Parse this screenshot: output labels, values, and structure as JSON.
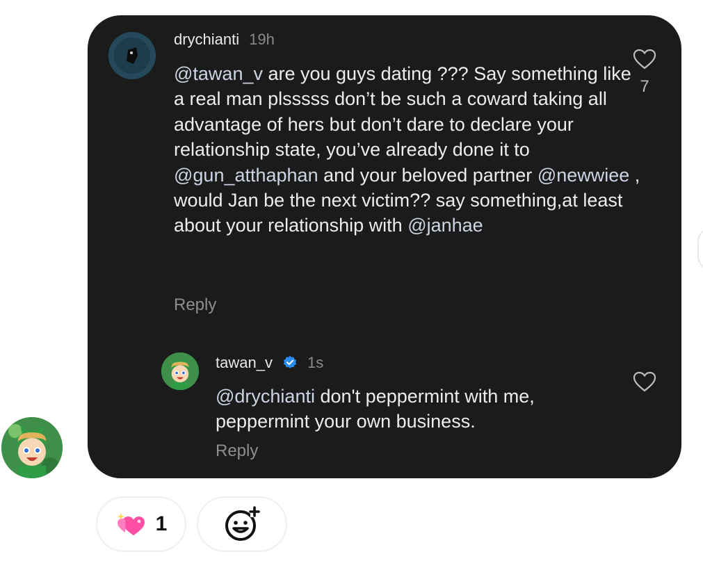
{
  "comments": [
    {
      "username": "drychianti",
      "time": "19h",
      "like_count": "7",
      "reply_label": "Reply",
      "segments": [
        {
          "text": "@tawan_v",
          "mention": true
        },
        {
          "text": " are you guys dating ??? Say something like a real man plsssss don’t be such a coward taking all advantage of hers but don’t dare to declare your relationship state, you’ve already done it to ",
          "mention": false
        },
        {
          "text": "@gun_atthaphan",
          "mention": true
        },
        {
          "text": " and your beloved partner ",
          "mention": false
        },
        {
          "text": "@newwiee",
          "mention": true
        },
        {
          "text": " , would Jan be the next victim?? say something,at least about your relationship with ",
          "mention": false
        },
        {
          "text": "@janhae",
          "mention": true
        }
      ]
    },
    {
      "username": "tawan_v",
      "verified": true,
      "time": "1s",
      "reply_label": "Reply",
      "segments": [
        {
          "text": "@drychianti",
          "mention": true
        },
        {
          "text": " don't peppermint with me, peppermint your own business.",
          "mention": false
        }
      ]
    }
  ],
  "reactions": [
    {
      "emoji": "sparkling-heart",
      "count": "1"
    }
  ],
  "colors": {
    "bubble": "#1b1b1b",
    "mention": "#cdd4e4",
    "verified": "#2a8ef0",
    "heart_emoji": "#ff4fa3"
  }
}
